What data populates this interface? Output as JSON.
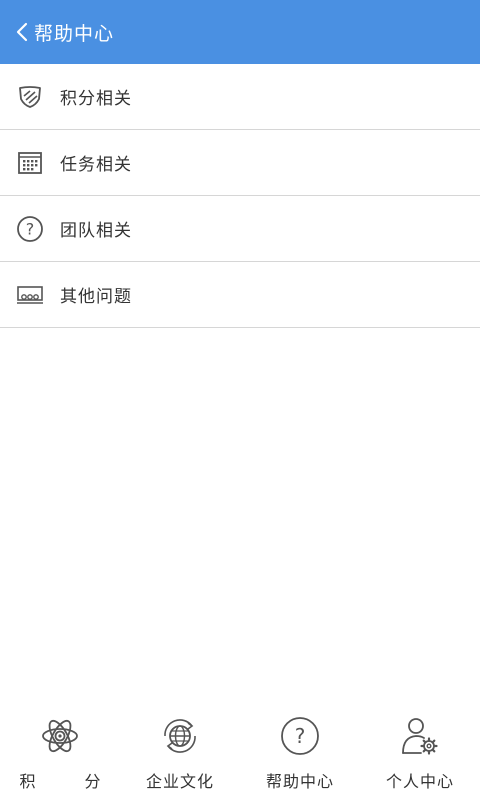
{
  "header": {
    "back_icon": "chevron-left-icon",
    "title": "帮助中心"
  },
  "menu": {
    "items": [
      {
        "label": "积分相关",
        "icon": "shield-icon"
      },
      {
        "label": "任务相关",
        "icon": "calendar-icon"
      },
      {
        "label": "团队相关",
        "icon": "question-circle-icon"
      },
      {
        "label": "其他问题",
        "icon": "meeting-icon"
      }
    ]
  },
  "tabbar": {
    "items": [
      {
        "label": "积 分",
        "icon": "atom-icon"
      },
      {
        "label": "企业文化",
        "icon": "globe-icon"
      },
      {
        "label": "帮助中心",
        "icon": "question-circle-icon"
      },
      {
        "label": "个人中心",
        "icon": "user-settings-icon"
      }
    ]
  },
  "colors": {
    "header_bg": "#4a90e2",
    "icon_stroke": "#555555",
    "divider": "#d6d6d6"
  }
}
